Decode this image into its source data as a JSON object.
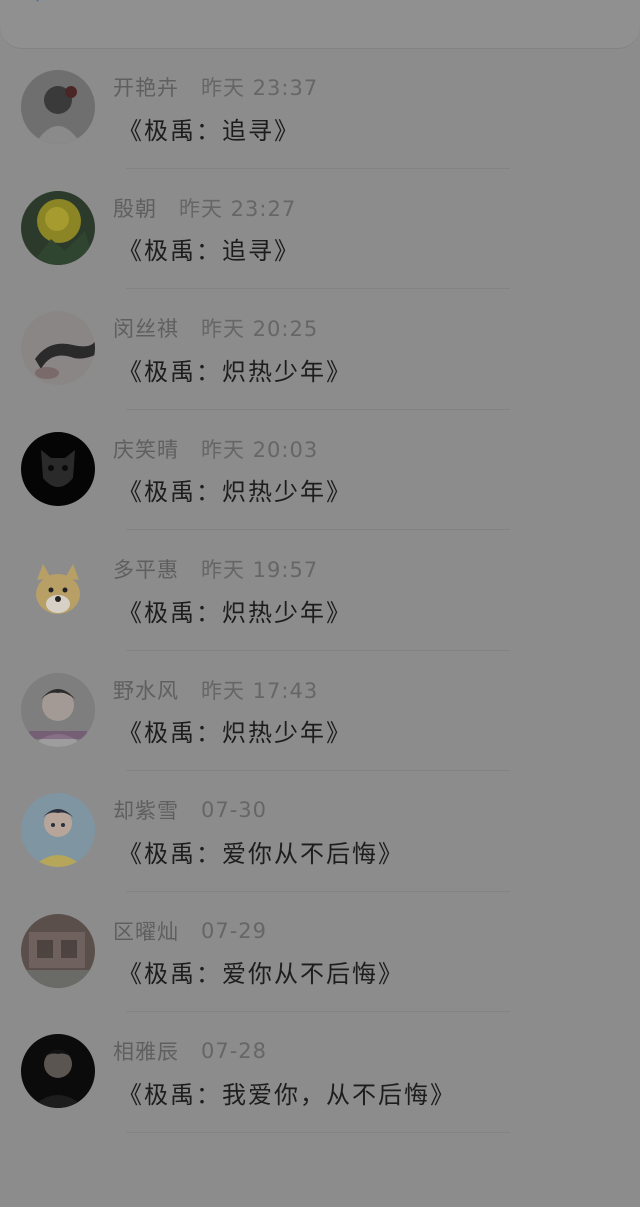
{
  "header": {
    "back_icon": "chevron-left-icon"
  },
  "items": [
    {
      "name": "开艳卉",
      "time": "昨天 23:37",
      "message": "《极禹：追寻》",
      "avatar": "avatar-icon"
    },
    {
      "name": "殷朝",
      "time": "昨天 23:27",
      "message": "《极禹：追寻》",
      "avatar": "avatar-icon"
    },
    {
      "name": "闵丝祺",
      "time": "昨天 20:25",
      "message": "《极禹：炽热少年》",
      "avatar": "avatar-icon"
    },
    {
      "name": "庆笑晴",
      "time": "昨天 20:03",
      "message": "《极禹：炽热少年》",
      "avatar": "avatar-icon"
    },
    {
      "name": "多平惠",
      "time": "昨天 19:57",
      "message": "《极禹：炽热少年》",
      "avatar": "avatar-icon"
    },
    {
      "name": "野水风",
      "time": "昨天 17:43",
      "message": "《极禹：炽热少年》",
      "avatar": "avatar-icon"
    },
    {
      "name": "却紫雪",
      "time": "07-30",
      "message": "《极禹：爱你从不后悔》",
      "avatar": "avatar-icon"
    },
    {
      "name": "区曜灿",
      "time": "07-29",
      "message": "《极禹：爱你从不后悔》",
      "avatar": "avatar-icon"
    },
    {
      "name": "相雅辰",
      "time": "07-28",
      "message": "《极禹：我爱你，从不后悔》",
      "avatar": "avatar-icon"
    }
  ]
}
